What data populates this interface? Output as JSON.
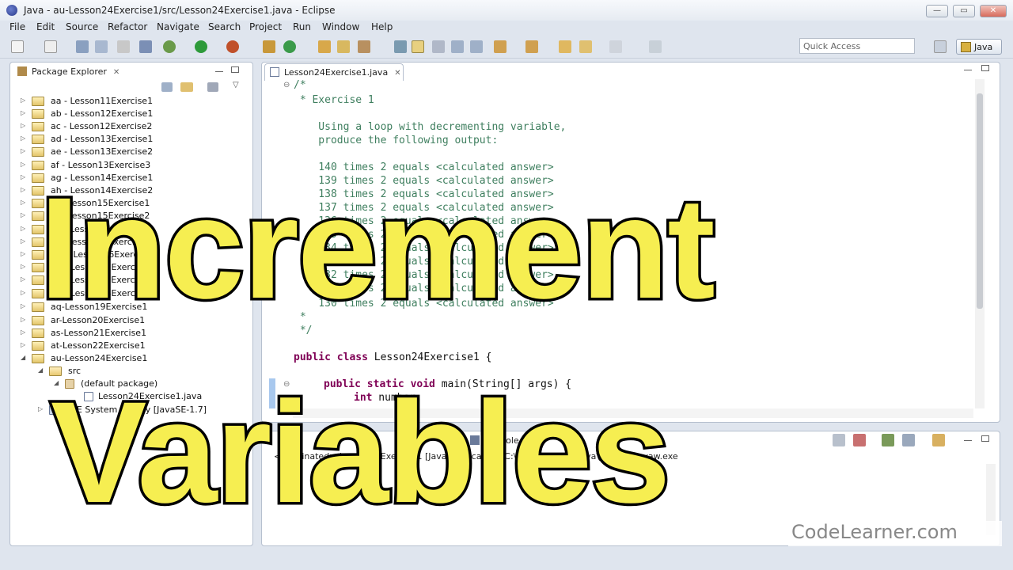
{
  "window": {
    "title": "Java - au-Lesson24Exercise1/src/Lesson24Exercise1.java - Eclipse",
    "controls": [
      "—",
      "▭",
      "✕"
    ]
  },
  "menu": [
    "File",
    "Edit",
    "Source",
    "Refactor",
    "Navigate",
    "Search",
    "Project",
    "Run",
    "Window",
    "Help"
  ],
  "toolbar": {
    "quick_access_placeholder": "Quick Access",
    "perspective": "Java"
  },
  "package_explorer": {
    "title": "Package Explorer",
    "projects": [
      "aa - Lesson11Exercise1",
      "ab - Lesson12Exercise1",
      "ac - Lesson12Exercise2",
      "ad - Lesson13Exercise1",
      "ae - Lesson13Exercise2",
      "af - Lesson13Exercise3",
      "ag - Lesson14Exercise1",
      "ah - Lesson14Exercise2",
      "ai - Lesson15Exercise1",
      "aj - Lesson15Exercise2",
      "ak - Lesson16Exercise1",
      "al - Lesson16Exercise2",
      "am - Lesson16Exercise1",
      "an - Lesson17Exercise2",
      "ao - Lesson17Exercise3",
      "ap - Lesson18Exercise1",
      "aq-Lesson19Exercise1",
      "ar-Lesson20Exercise1",
      "as-Lesson21Exercise1",
      "at-Lesson22Exercise1",
      "au-Lesson24Exercise1"
    ],
    "src": "src",
    "default_package": "(default package)",
    "java_file": "Lesson24Exercise1.java",
    "jre": "JRE System Library [JavaSE-1.7]"
  },
  "editor": {
    "tab": "Lesson24Exercise1.java",
    "lines": [
      "/*",
      " * Exercise 1",
      "",
      "    Using a loop with decrementing variable,",
      "    produce the following output:",
      "",
      "    140 times 2 equals <calculated answer>",
      "    139 times 2 equals <calculated answer>",
      "    138 times 2 equals <calculated answer>",
      "    137 times 2 equals <calculated answer>",
      "    136 times 2 equals <calculated answer>",
      "    135 times 2 equals <calculated answer>",
      "    134 times 2 equals <calculated answer>",
      "    133 times 2 equals <calculated answer>",
      "    132 times 2 equals <calculated answer>",
      "    131 times 2 equals <calculated answer>",
      "    130 times 2 equals <calculated answer>",
      " *",
      " */"
    ],
    "class_decl": {
      "kw": "public class",
      "rest": " Lesson24Exercise1 {"
    },
    "main_decl": {
      "kw": "public static void",
      "rest": " main(String[] args) {"
    },
    "var_decl": {
      "kw": "int",
      "rest": " number;"
    }
  },
  "console": {
    "tab": "Console",
    "line": "<terminated> Lesson24Exercise1 [Java Application] C:\\Program Files\\Java\\jre7\\bin\\javaw.exe"
  },
  "overlay": {
    "line1": "Increment",
    "line2": "Variables",
    "brand": "CodeLearner.com"
  },
  "colors": {
    "overlay_fill": "#f6ee51",
    "keyword": "#7f0055",
    "comment": "#3f7f5f"
  }
}
